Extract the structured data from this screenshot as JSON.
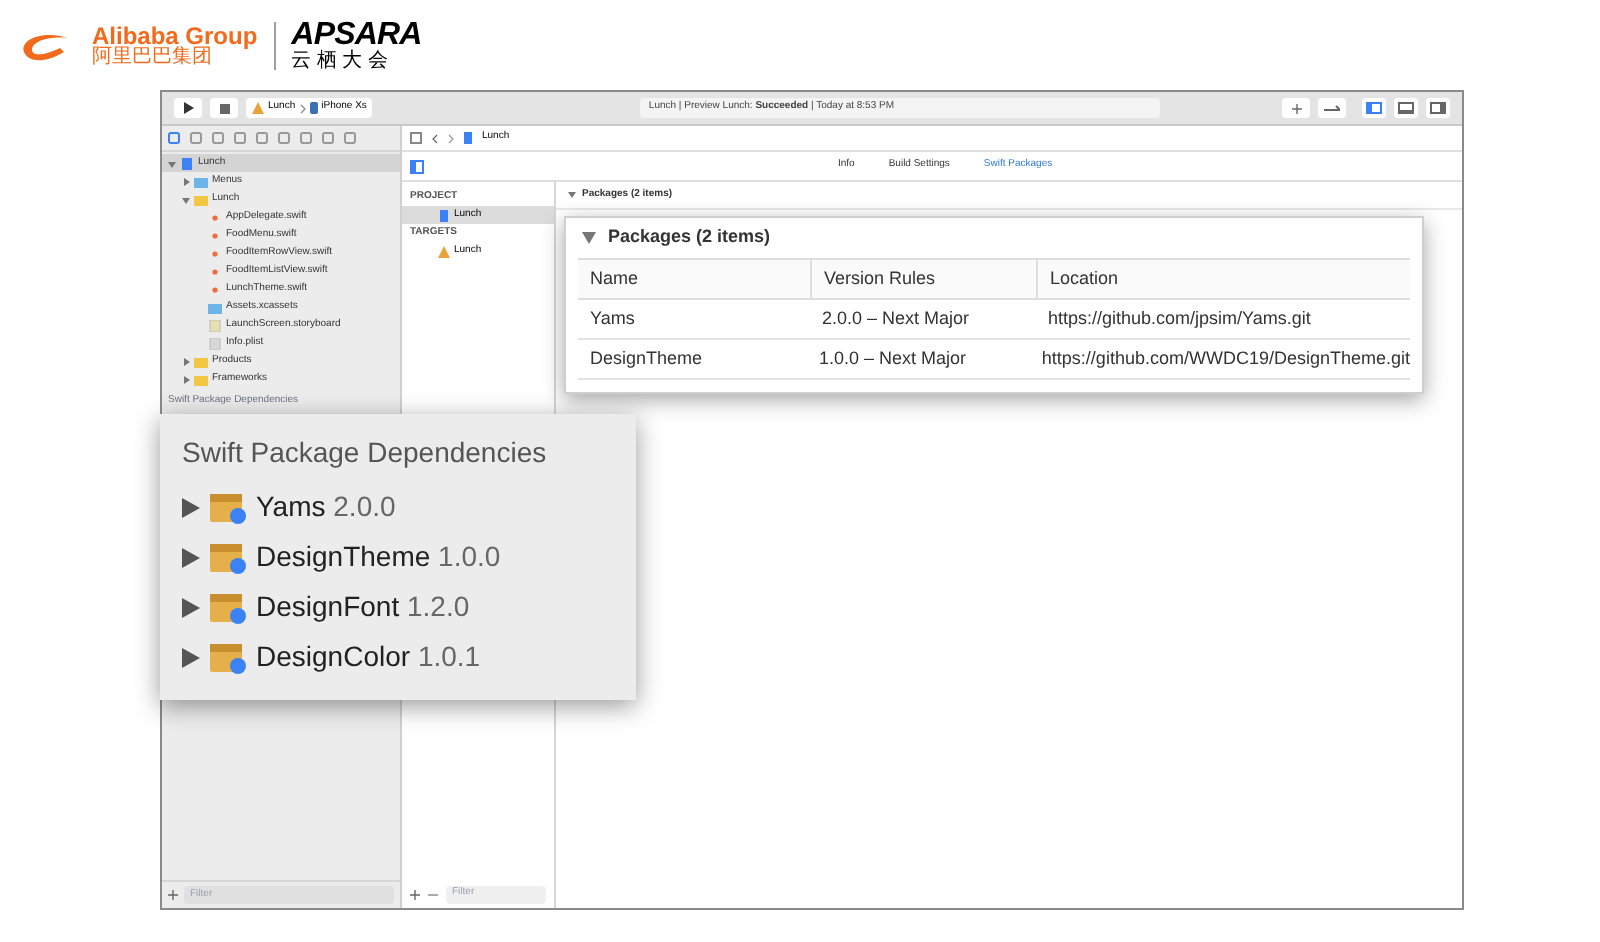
{
  "header": {
    "brand": "Alibaba Group",
    "brand_cn": "阿里巴巴集团",
    "event": "APSARA",
    "event_cn": "云 栖 大 会"
  },
  "toolbar": {
    "scheme": "Lunch",
    "device": "iPhone Xs",
    "status": "Lunch | Preview Lunch: **Succeeded** | Today at 8:53 PM"
  },
  "navigator": {
    "items": [
      {
        "label": "Lunch",
        "kind": "project",
        "selected": true,
        "expanded": true,
        "children": [
          {
            "label": "Menus",
            "kind": "folder",
            "selected": false,
            "expanded": false
          },
          {
            "label": "Lunch",
            "kind": "group",
            "selected": false,
            "expanded": true,
            "children": [
              {
                "label": "AppDelegate.swift",
                "kind": "swift",
                "selected": false
              },
              {
                "label": "FoodMenu.swift",
                "kind": "swift",
                "selected": false
              },
              {
                "label": "FoodItemRowView.swift",
                "kind": "swift",
                "selected": false
              },
              {
                "label": "FoodItemListView.swift",
                "kind": "swift",
                "selected": false
              },
              {
                "label": "LunchTheme.swift",
                "kind": "swift",
                "selected": false
              },
              {
                "label": "Assets.xcassets",
                "kind": "folder",
                "selected": false
              },
              {
                "label": "LaunchScreen.storyboard",
                "kind": "storyboard",
                "selected": false
              },
              {
                "label": "Info.plist",
                "kind": "plist",
                "selected": false
              }
            ]
          },
          {
            "label": "Products",
            "kind": "group",
            "selected": false,
            "expanded": false
          },
          {
            "label": "Frameworks",
            "kind": "group",
            "selected": false,
            "expanded": false
          }
        ]
      }
    ],
    "section": "Swift Package Dependencies",
    "filter_placeholder": "Filter"
  },
  "breadcrumb": "Lunch",
  "editor_tabs": [
    {
      "label": "Info",
      "selected": false
    },
    {
      "label": "Build Settings",
      "selected": false
    },
    {
      "label": "Swift Packages",
      "selected": true
    }
  ],
  "project_list": {
    "project_header": "PROJECT",
    "projects": [
      {
        "label": "Lunch",
        "selected": true
      }
    ],
    "targets_header": "TARGETS",
    "targets": [
      {
        "label": "Lunch",
        "selected": false
      }
    ],
    "filter_placeholder": "Filter"
  },
  "packages_section": "Packages (2 items)",
  "packages_callout": {
    "title": "Packages (2 items)",
    "columns": [
      "Name",
      "Version Rules",
      "Location"
    ],
    "rows": [
      [
        "Yams",
        "2.0.0 – Next Major",
        "https://github.com/jpsim/Yams.git"
      ],
      [
        "DesignTheme",
        "1.0.0 – Next Major",
        "https://github.com/WWDC19/DesignTheme.git"
      ]
    ]
  },
  "dependencies_callout": {
    "title": "Swift Package Dependencies",
    "items": [
      {
        "name": "Yams",
        "version": "2.0.0"
      },
      {
        "name": "DesignTheme",
        "version": "1.0.0"
      },
      {
        "name": "DesignFont",
        "version": "1.2.0"
      },
      {
        "name": "DesignColor",
        "version": "1.0.1"
      }
    ]
  }
}
